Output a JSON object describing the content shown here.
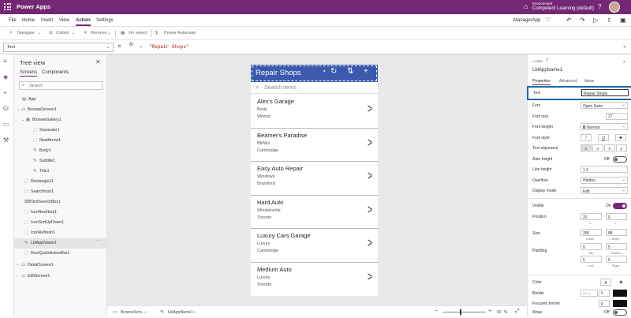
{
  "titlebar": {
    "app": "Power Apps",
    "env_label": "Environment",
    "env_name": "Competent Learning (default)"
  },
  "menu": {
    "items": [
      "File",
      "Home",
      "Insert",
      "View",
      "Action",
      "Settings"
    ],
    "active": "Action",
    "app_name": "ManagerApp"
  },
  "toolbar": {
    "navigate": "Navigate",
    "collect": "Collect",
    "remove": "Remove",
    "on_select": "On select",
    "power_automate": "Power Automate"
  },
  "formula": {
    "property": "Text",
    "fx": "fx",
    "value": "\"Repair Shops\""
  },
  "tree": {
    "title": "Tree view",
    "tabs": [
      "Screens",
      "Components"
    ],
    "search_placeholder": "Search",
    "nodes": [
      "App",
      "BrowseScreen1",
      "BrowseGallery1",
      "Separator1",
      "NextArrow1",
      "Body1",
      "Subtitle1",
      "Title1",
      "Rectangle11",
      "SearchIcon1",
      "TextSearchBox1",
      "IconNewItem1",
      "IconSortUpDown1",
      "IconRefresh1",
      "LblAppName1",
      "RectQuickActionBar1",
      "DetailScreen1",
      "EditScreen1"
    ]
  },
  "app": {
    "header_title": "Repair Shops",
    "search_placeholder": "Search items",
    "items": [
      {
        "name": "Alex's Garage",
        "sub": "Body",
        "city": "Wilmot"
      },
      {
        "name": "Beamer's Paradise",
        "sub": "BMWs",
        "city": "Cambridge"
      },
      {
        "name": "Easy Auto Repair",
        "sub": "Windows",
        "city": "Brantford"
      },
      {
        "name": "Hard Auto",
        "sub": "Windshields",
        "city": "Toronto"
      },
      {
        "name": "Luxury Cars Garage",
        "sub": "Luxury",
        "city": "Cambridge"
      },
      {
        "name": "Medium Auto",
        "sub": "Luxury",
        "city": "Toronto"
      }
    ]
  },
  "status": {
    "screen": "BrowseScre...",
    "control": "LblAppName1",
    "zoom": "60",
    "zoom_unit": "%"
  },
  "props": {
    "type": "LABEL",
    "name": "LblAppName1",
    "tabs": [
      "Properties",
      "Advanced",
      "Ideas"
    ],
    "text_label": "Text",
    "text_value": "Repair Shops",
    "font_label": "Font",
    "font_value": "Open Sans",
    "font_size_label": "Font size",
    "font_size_value": "27",
    "font_weight_label": "Font weight",
    "font_weight_value": "Normal",
    "font_style_label": "Font style",
    "text_align_label": "Text alignment",
    "auto_height_label": "Auto height",
    "auto_height_value": "Off",
    "line_height_label": "Line height",
    "line_height_value": "1.2",
    "overflow_label": "Overflow",
    "overflow_value": "Hidden",
    "display_mode_label": "Display mode",
    "display_mode_value": "Edit",
    "visible_label": "Visible",
    "visible_value": "On",
    "position_label": "Position",
    "pos_x": "20",
    "pos_y": "0",
    "x_label": "X",
    "y_label": "Y",
    "size_label": "Size",
    "width": "356",
    "height": "88",
    "width_label": "Width",
    "height_label": "Height",
    "padding_label": "Padding",
    "pad_top": "5",
    "pad_bottom": "5",
    "pad_left": "5",
    "pad_right": "5",
    "top_label": "Top",
    "bottom_label": "Bottom",
    "left_label": "Left",
    "right_label": "Right",
    "color_label": "Color",
    "border_label": "Border",
    "border_value": "0",
    "focused_border_label": "Focused border",
    "focused_border_value": "0",
    "wrap_label": "Wrap",
    "wrap_value": "Off"
  },
  "colors": {
    "brand": "#742774",
    "header": "#3b5aae",
    "highlight": "#1c69a9"
  }
}
